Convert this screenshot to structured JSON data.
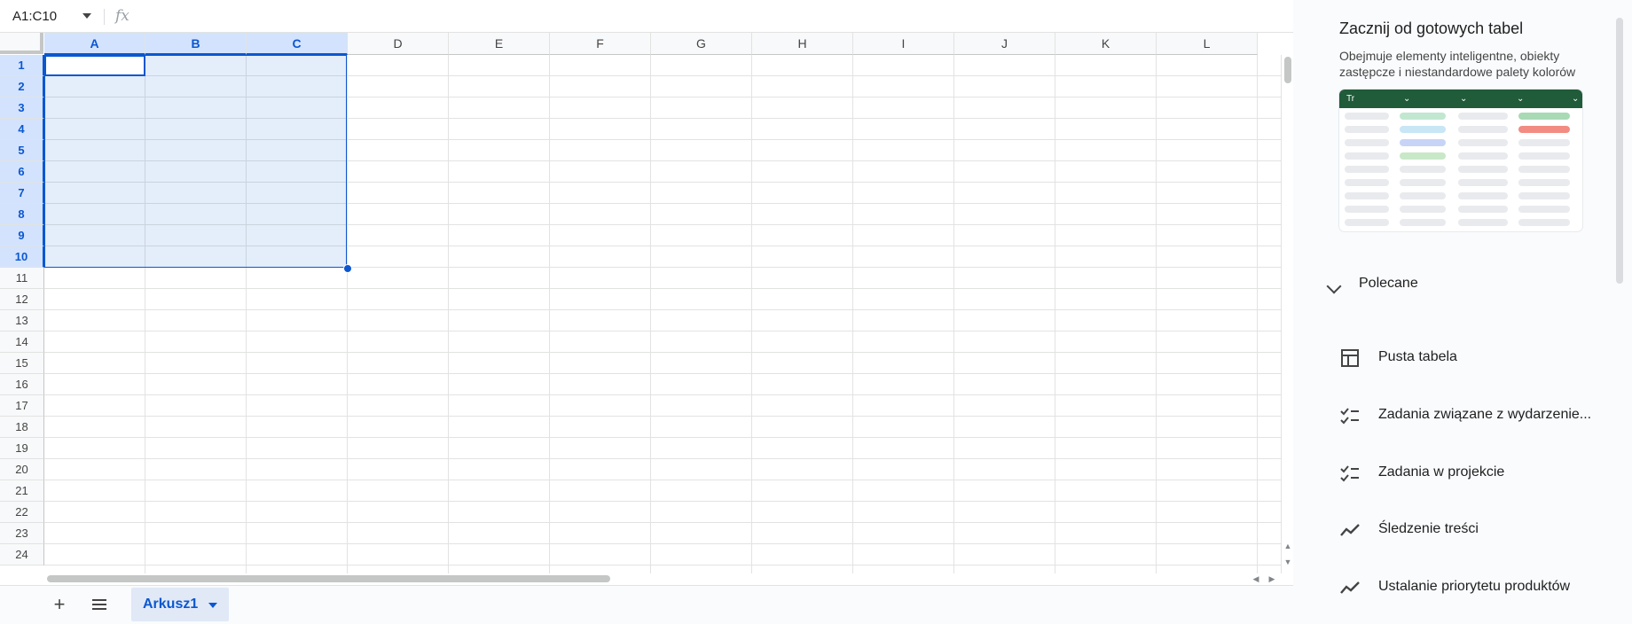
{
  "name_box": "A1:C10",
  "formula_icon": "fx",
  "columns": [
    "A",
    "B",
    "C",
    "D",
    "E",
    "F",
    "G",
    "H",
    "I",
    "J",
    "K",
    "L"
  ],
  "selected_columns": [
    "A",
    "B",
    "C"
  ],
  "rows": [
    "1",
    "2",
    "3",
    "4",
    "5",
    "6",
    "7",
    "8",
    "9",
    "10",
    "11",
    "12",
    "13",
    "14",
    "15",
    "16",
    "17",
    "18",
    "19",
    "20",
    "21",
    "22",
    "23",
    "24"
  ],
  "selected_rows_count": 10,
  "sheet_tabs": [
    {
      "label": "Arkusz1",
      "active": true
    }
  ],
  "scroll_buttons": {
    "up": "▲",
    "down": "▼",
    "left": "◀",
    "right": "▶"
  },
  "panel": {
    "title": "Zacznij od gotowych tabel",
    "subtitle": "Obejmuje elementy inteligentne, obiekty zastępcze i niestandardowe palety kolorów",
    "preview_header_label": "Tr",
    "section_label": "Polecane",
    "items": [
      {
        "label": "Pusta tabela",
        "icon": "table-icon"
      },
      {
        "label": "Zadania związane z wydarzenie...",
        "icon": "checklist-icon"
      },
      {
        "label": "Zadania w projekcie",
        "icon": "checklist-icon"
      },
      {
        "label": "Śledzenie treści",
        "icon": "trend-icon"
      },
      {
        "label": "Ustalanie priorytetu produktów",
        "icon": "trend-icon"
      }
    ]
  },
  "colors": {
    "accent": "#0b57d0",
    "selection": "#d3e3fd",
    "preview_header": "#205b3a"
  }
}
